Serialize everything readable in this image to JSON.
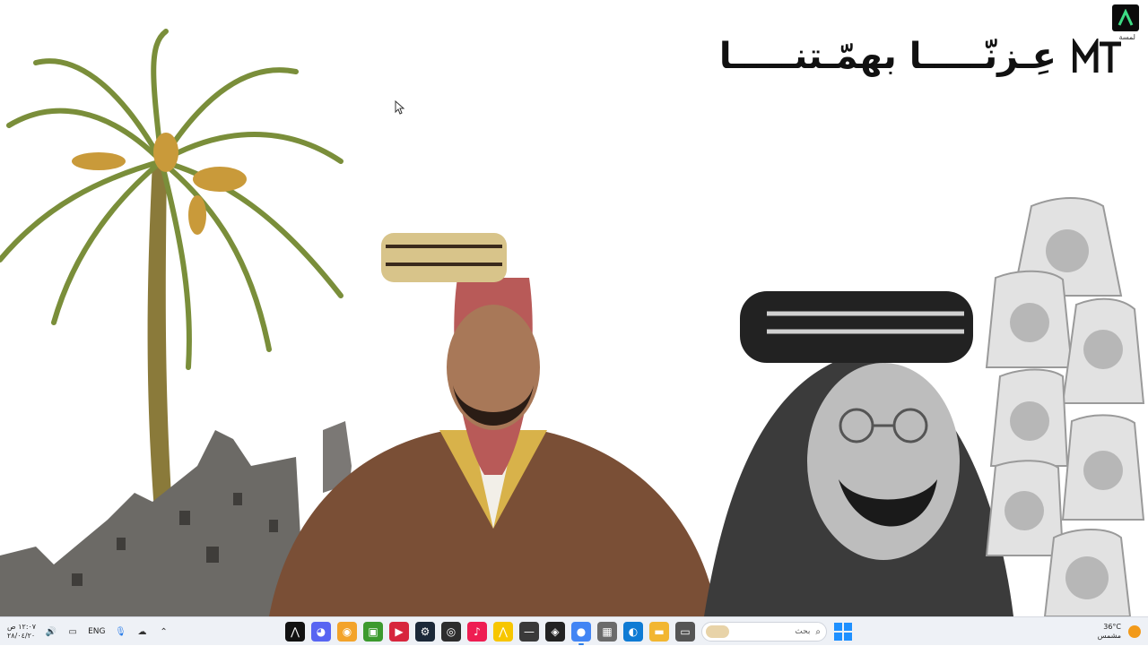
{
  "title": {
    "text": "عِـزنّـــــا بهمّـتنـــــا",
    "logo": "MT"
  },
  "app_badge": {
    "label": "لمسة"
  },
  "taskbar": {
    "clock_time": "١٢:٠٧ ص",
    "clock_date": "٢٨/٠٤/٢٠",
    "language": "ENG",
    "search_placeholder": "بحث",
    "weather_temp": "36°C",
    "weather_desc": "مشمس",
    "tray_icons": [
      "speaker-icon",
      "network-icon",
      "microphone-icon",
      "onedrive-icon",
      "chevron-up-icon"
    ],
    "apps": [
      {
        "name": "capcut-icon",
        "color": "#111111",
        "glyph": "⋀"
      },
      {
        "name": "discord-icon",
        "color": "#5865f2",
        "glyph": "◕"
      },
      {
        "name": "browser-icon",
        "color": "#f3a32a",
        "glyph": "◉"
      },
      {
        "name": "minecraft-icon",
        "color": "#3c9a2e",
        "glyph": "▣"
      },
      {
        "name": "media-icon",
        "color": "#d7263d",
        "glyph": "▶"
      },
      {
        "name": "steam-icon",
        "color": "#1b2838",
        "glyph": "⚙"
      },
      {
        "name": "obs-icon",
        "color": "#2d2d2d",
        "glyph": "◎"
      },
      {
        "name": "tiktok-icon",
        "color": "#ee1d52",
        "glyph": "♪"
      },
      {
        "name": "adobe-icon",
        "color": "#f7c600",
        "glyph": "⋀"
      },
      {
        "name": "terminal-icon",
        "color": "#3a3a3a",
        "glyph": "—"
      },
      {
        "name": "capture-icon",
        "color": "#222222",
        "glyph": "◈"
      },
      {
        "name": "chrome-icon",
        "color": "#4285f4",
        "glyph": "●",
        "active": true
      },
      {
        "name": "store-icon",
        "color": "#6b6b6b",
        "glyph": "▦"
      },
      {
        "name": "edge-icon",
        "color": "#0f7bd4",
        "glyph": "◐"
      },
      {
        "name": "folder-icon",
        "color": "#f2b631",
        "glyph": "▬"
      },
      {
        "name": "taskview-icon",
        "color": "#555555",
        "glyph": "▭"
      }
    ]
  },
  "colors": {
    "taskbar_bg": "#eef1f6",
    "accent": "#2b7de9",
    "start": "#1e90ff"
  }
}
